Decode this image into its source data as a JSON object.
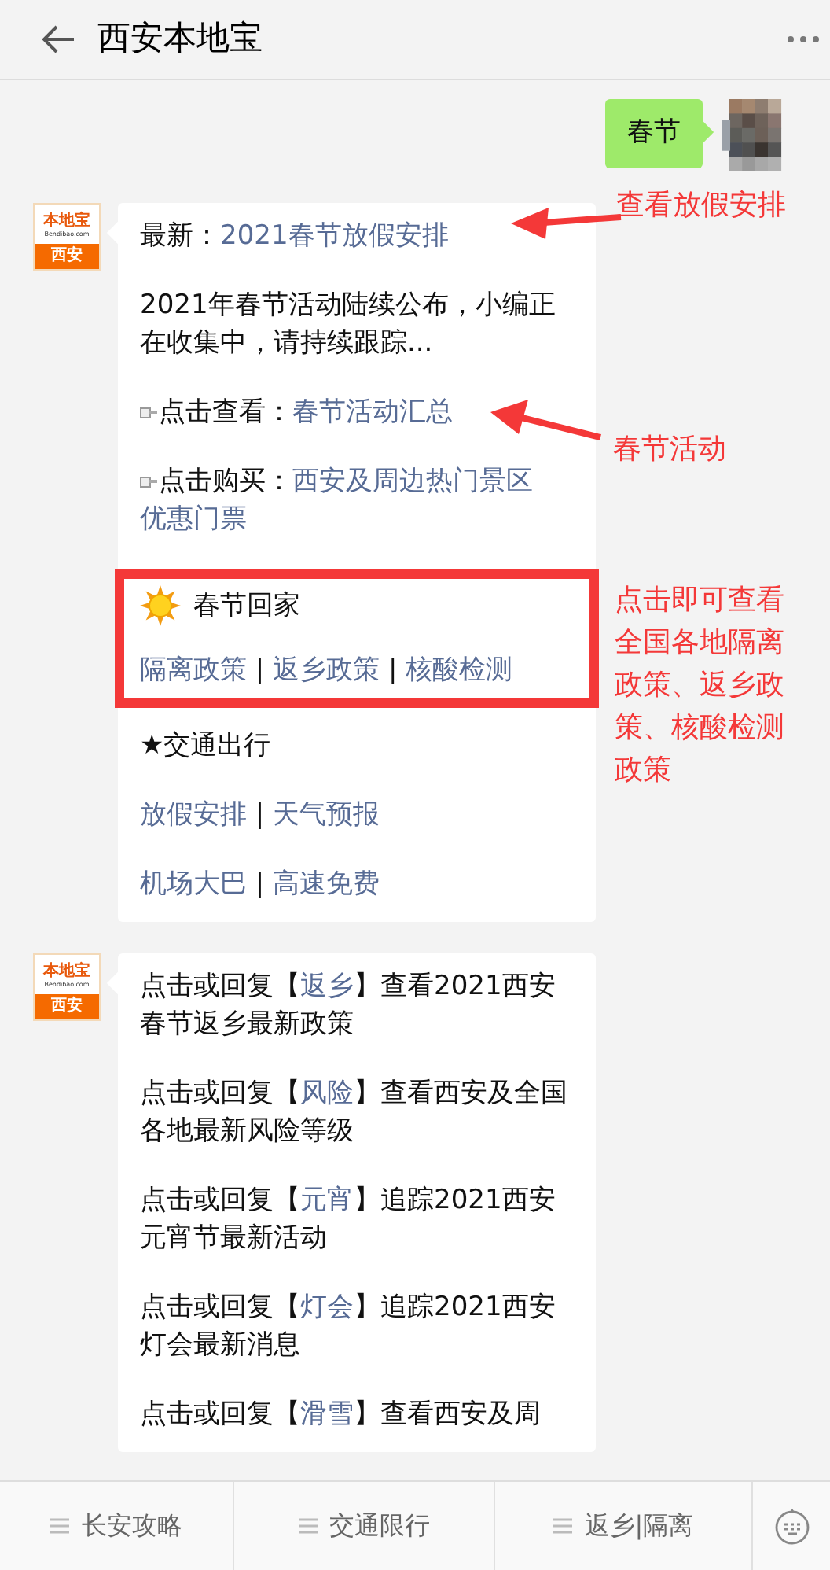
{
  "header": {
    "title": "西安本地宝"
  },
  "messages": [
    {
      "kind": "outgoing",
      "text": "春节"
    },
    {
      "kind": "incoming",
      "avatar": {
        "brand": "本地宝",
        "domain": "Bendibao.com",
        "city": "西安"
      },
      "paragraphs": [
        {
          "kind": "text",
          "segments": [
            {
              "text": "最新：",
              "link": false
            },
            {
              "text": "2021春节放假安排",
              "link": true
            }
          ]
        },
        {
          "kind": "text",
          "segments": [
            {
              "text": "2021年春节活动陆续公布，小编正在收集中，请持续跟踪...",
              "link": false
            }
          ]
        },
        {
          "kind": "bullet",
          "segments": [
            {
              "text": "点击查看：",
              "link": false
            },
            {
              "text": "春节活动汇总",
              "link": true
            }
          ]
        },
        {
          "kind": "bullet",
          "segments": [
            {
              "text": "点击购买：",
              "link": false
            },
            {
              "text": "西安及周边热门景区",
              "link": true
            },
            {
              "text": "优惠门票",
              "link": true
            }
          ]
        },
        {
          "kind": "highlight",
          "title": "春节回家",
          "segments": [
            {
              "text": "隔离政策",
              "link": true
            },
            {
              "text": " | ",
              "link": false
            },
            {
              "text": "返乡政策",
              "link": true
            },
            {
              "text": " | ",
              "link": false
            },
            {
              "text": "核酸检测",
              "link": true
            }
          ]
        },
        {
          "kind": "text",
          "segments": [
            {
              "text": "★交通出行",
              "link": false
            }
          ]
        },
        {
          "kind": "text",
          "segments": [
            {
              "text": "放假安排",
              "link": true
            },
            {
              "text": " | ",
              "link": false
            },
            {
              "text": "天气预报",
              "link": true
            }
          ]
        },
        {
          "kind": "text",
          "segments": [
            {
              "text": "机场大巴",
              "link": true
            },
            {
              "text": " | ",
              "link": false
            },
            {
              "text": "高速免费",
              "link": true
            }
          ]
        }
      ]
    },
    {
      "kind": "incoming",
      "avatar": {
        "brand": "本地宝",
        "domain": "Bendibao.com",
        "city": "西安"
      },
      "paragraphs": [
        {
          "kind": "text",
          "segments": [
            {
              "text": "点击或回复【",
              "link": false
            },
            {
              "text": "返乡",
              "link": true
            },
            {
              "text": "】查看2021西安春节返乡最新政策",
              "link": false
            }
          ]
        },
        {
          "kind": "text",
          "segments": [
            {
              "text": "点击或回复【",
              "link": false
            },
            {
              "text": "风险",
              "link": true
            },
            {
              "text": "】查看西安及全国各地最新风险等级",
              "link": false
            }
          ]
        },
        {
          "kind": "text",
          "segments": [
            {
              "text": "点击或回复【",
              "link": false
            },
            {
              "text": "元宵",
              "link": true
            },
            {
              "text": "】追踪2021西安元宵节最新活动",
              "link": false
            }
          ]
        },
        {
          "kind": "text",
          "segments": [
            {
              "text": "点击或回复【",
              "link": false
            },
            {
              "text": "灯会",
              "link": true
            },
            {
              "text": "】追踪2021西安灯会最新消息",
              "link": false
            }
          ]
        },
        {
          "kind": "text",
          "segments": [
            {
              "text": "点击或回复【",
              "link": false
            },
            {
              "text": "滑雪",
              "link": true
            },
            {
              "text": "】查看西安及周",
              "link": false
            }
          ]
        }
      ]
    }
  ],
  "annotations": [
    {
      "kind": "arrow",
      "text": "查看放假安排"
    },
    {
      "kind": "arrow",
      "text": "春节活动"
    },
    {
      "kind": "note",
      "text": "点击即可查看全国各地隔离政策、返乡政策、核酸检测政策"
    }
  ],
  "menu": [
    {
      "label": "长安攻略"
    },
    {
      "label": "交通限行"
    },
    {
      "label": "返乡|隔离"
    }
  ]
}
